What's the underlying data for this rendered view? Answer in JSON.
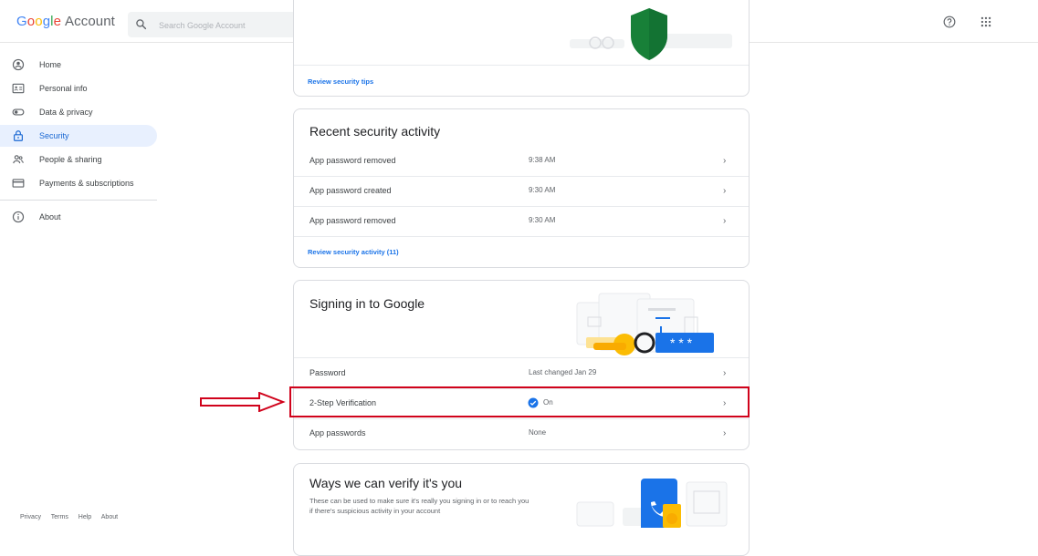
{
  "header": {
    "logo_letters": [
      "G",
      "o",
      "o",
      "g",
      "l",
      "e"
    ],
    "logo_suffix": "Account",
    "search_placeholder": "Search Google Account",
    "icons": [
      "search-icon",
      "help-icon",
      "apps-grid-icon"
    ]
  },
  "sidebar": {
    "items": [
      {
        "label": "Home",
        "icon": "home-icon",
        "active": false
      },
      {
        "label": "Personal info",
        "icon": "id-card-icon",
        "active": false
      },
      {
        "label": "Data & privacy",
        "icon": "toggle-icon",
        "active": false
      },
      {
        "label": "Security",
        "icon": "lock-icon",
        "active": true
      },
      {
        "label": "People & sharing",
        "icon": "people-icon",
        "active": false
      },
      {
        "label": "Payments & subscriptions",
        "icon": "credit-card-icon",
        "active": false
      },
      {
        "label": "About",
        "icon": "info-icon",
        "active": false
      }
    ],
    "footer": [
      "Privacy",
      "Terms",
      "Help",
      "About"
    ]
  },
  "tips_card": {
    "link": "Review security tips"
  },
  "activity_card": {
    "title": "Recent security activity",
    "rows": [
      {
        "label": "App password removed",
        "value": "9:38 AM"
      },
      {
        "label": "App password created",
        "value": "9:30 AM"
      },
      {
        "label": "App password removed",
        "value": "9:30 AM"
      }
    ],
    "link": "Review security activity (11)"
  },
  "signin_card": {
    "title": "Signing in to Google",
    "password_label": "Password",
    "password_value": "Last changed Jan 29",
    "twostep_label": "2-Step Verification",
    "twostep_value": "On",
    "apppw_label": "App passwords",
    "apppw_value": "None",
    "illustration_text": "* * *"
  },
  "verify_card": {
    "title": "Ways we can verify it's you",
    "description_line1": "These can be used to make sure it's really you signing in or to reach you",
    "description_line2": "if there's suspicious activity in your account"
  },
  "chevron": "›",
  "colors": {
    "accent": "#1a73e8",
    "active_bg": "#e8f0fe",
    "highlight": "#d0021b",
    "shield": "#188038"
  }
}
